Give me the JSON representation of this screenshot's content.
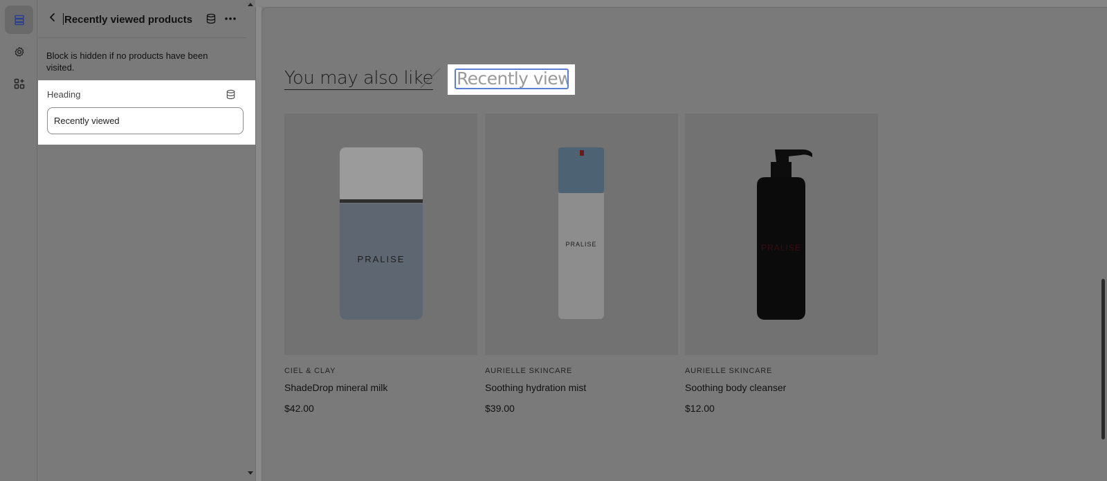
{
  "rail": {
    "items": [
      {
        "icon": "sections-icon",
        "active": true
      },
      {
        "icon": "gear-icon",
        "active": false
      },
      {
        "icon": "apps-add-icon",
        "active": false
      }
    ]
  },
  "panel": {
    "title": "Recently viewed products",
    "notice": "Block is hidden if no products have been visited.",
    "field_label": "Heading",
    "field_value": "Recently viewed"
  },
  "preview": {
    "tab_primary": "You may also like",
    "tab_secondary": "Recently viewed",
    "products": [
      {
        "vendor": "CIEL & CLAY",
        "title": "ShadeDrop mineral milk",
        "price": "$42.00",
        "brand_mark": "PRALISE"
      },
      {
        "vendor": "AURIELLE SKINCARE",
        "title": "Soothing hydration mist",
        "price": "$39.00",
        "brand_mark": "PRALISE"
      },
      {
        "vendor": "AURIELLE SKINCARE",
        "title": "Soothing body cleanser",
        "price": "$12.00",
        "brand_mark": "PRALISE"
      }
    ]
  },
  "colors": {
    "overlay_gray": "#7a7a7a",
    "focus_blue": "#5b7fd6",
    "active_icon": "#2b3f8f"
  }
}
